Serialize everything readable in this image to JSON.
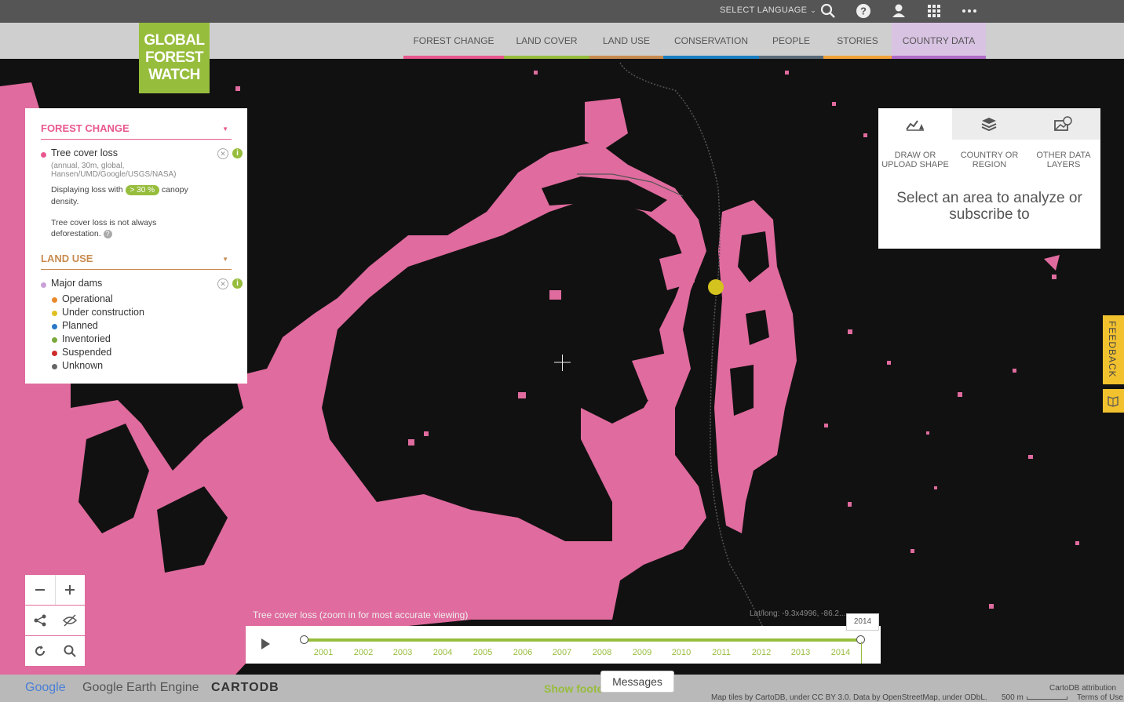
{
  "topbar": {
    "language_label": "SELECT LANGUAGE",
    "icons": [
      "search-icon",
      "help-icon",
      "user-icon",
      "apps-grid-icon",
      "more-icon"
    ]
  },
  "logo": {
    "line1": "GLOBAL",
    "line2": "FOREST",
    "line3": "WATCH"
  },
  "nav": {
    "items": [
      {
        "label": "FOREST CHANGE",
        "color": "#e8588f"
      },
      {
        "label": "LAND COVER",
        "color": "#97bd3d"
      },
      {
        "label": "LAND USE",
        "color": "#c88b4f"
      },
      {
        "label": "CONSERVATION",
        "color": "#1a7fc2"
      },
      {
        "label": "PEOPLE",
        "color": "#5a6b7a"
      },
      {
        "label": "STORIES",
        "color": "#f2a33a"
      },
      {
        "label": "COUNTRY DATA",
        "color": "#b06cc9"
      }
    ]
  },
  "legend": {
    "forest_change": {
      "title": "FOREST CHANGE",
      "layer_name": "Tree cover loss",
      "layer_desc": "(annual, 30m, global, Hansen/UMD/Google/USGS/NASA)",
      "displaying_prefix": "Displaying loss with",
      "canopy_badge": "> 30 %",
      "canopy_suffix": "canopy",
      "density": "density.",
      "note": "Tree cover loss is not always deforestation."
    },
    "land_use": {
      "title": "LAND USE",
      "layer_name": "Major dams",
      "categories": [
        {
          "label": "Operational",
          "color": "#e88a2a"
        },
        {
          "label": "Under construction",
          "color": "#e0c020"
        },
        {
          "label": "Planned",
          "color": "#2a78c8"
        },
        {
          "label": "Inventoried",
          "color": "#7aa83a"
        },
        {
          "label": "Suspended",
          "color": "#d02a2a"
        },
        {
          "label": "Unknown",
          "color": "#666666"
        }
      ]
    }
  },
  "analysis": {
    "tabs": [
      {
        "label": "DRAW OR UPLOAD SHAPE",
        "icon": "draw-shape-icon"
      },
      {
        "label": "COUNTRY OR REGION",
        "icon": "layers-icon"
      },
      {
        "label": "OTHER DATA LAYERS",
        "icon": "other-layers-icon"
      }
    ],
    "prompt": "Select an area to analyze or subscribe to"
  },
  "feedback_label": "FEEDBACK",
  "timeline": {
    "layer_label": "Tree cover loss (zoom in for most accurate viewing)",
    "latlong": "Lat/long: -9.3x4996, -86.2...",
    "years": [
      "2001",
      "2002",
      "2003",
      "2004",
      "2005",
      "2006",
      "2007",
      "2008",
      "2009",
      "2010",
      "2011",
      "2012",
      "2013",
      "2014"
    ],
    "selected_end": "2014"
  },
  "footer": {
    "google": "Google",
    "earth_engine": "Google Earth Engine",
    "cartodb": "CARTODB",
    "show_footer": "Show footer",
    "messages": "Messages",
    "attribution": "Map tiles by CartoDB, under CC BY 3.0. Data by OpenStreetMap, under ODbL.",
    "cartodb_attribution": "CartoDB attribution",
    "scale": "500 m",
    "terms": "Terms of Use"
  },
  "map_colors": {
    "loss": "#e06b9e",
    "background": "#111111",
    "dam_marker": "#d4c21e"
  }
}
